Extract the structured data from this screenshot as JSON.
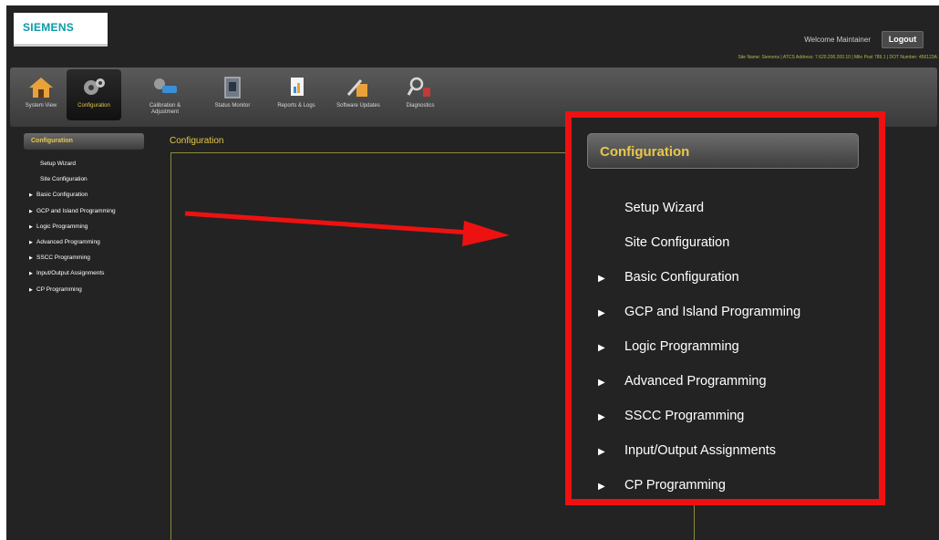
{
  "header": {
    "logo": "SIEMENS",
    "welcome": "Welcome Maintainer",
    "logout_label": "Logout",
    "site_info": "Site Name: Siemens | ATCS Address: 7.620.200.200.10 | Mile Post 789.1 | DOT Number: 456123A"
  },
  "toolbar": {
    "items": [
      {
        "label": "System View"
      },
      {
        "label": "Configuration"
      },
      {
        "label": "Calibration & Adjustment"
      },
      {
        "label": "Status Monitor"
      },
      {
        "label": "Reports & Logs"
      },
      {
        "label": "Software Updates"
      },
      {
        "label": "Diagnostics"
      }
    ]
  },
  "sidebar": {
    "header": "Configuration",
    "items": [
      {
        "label": "Setup Wizard"
      },
      {
        "label": "Site Configuration"
      },
      {
        "label": "Basic Configuration"
      },
      {
        "label": "GCP and Island Programming"
      },
      {
        "label": "Logic Programming"
      },
      {
        "label": "Advanced Programming"
      },
      {
        "label": "SSCC Programming"
      },
      {
        "label": "Input/Output Assignments"
      },
      {
        "label": "CP Programming"
      }
    ]
  },
  "main": {
    "title": "Configuration"
  },
  "zoom": {
    "header": "Configuration",
    "items": [
      {
        "label": "Setup Wizard"
      },
      {
        "label": "Site Configuration"
      },
      {
        "label": "Basic Configuration"
      },
      {
        "label": "GCP and Island Programming"
      },
      {
        "label": "Logic Programming"
      },
      {
        "label": "Advanced Programming"
      },
      {
        "label": "SSCC Programming"
      },
      {
        "label": "Input/Output Assignments"
      },
      {
        "label": "CP Programming"
      }
    ]
  },
  "colors": {
    "accent": "#e8c84a",
    "highlight": "#ee1111",
    "brand": "#0a9aa8",
    "background": "#232323"
  }
}
